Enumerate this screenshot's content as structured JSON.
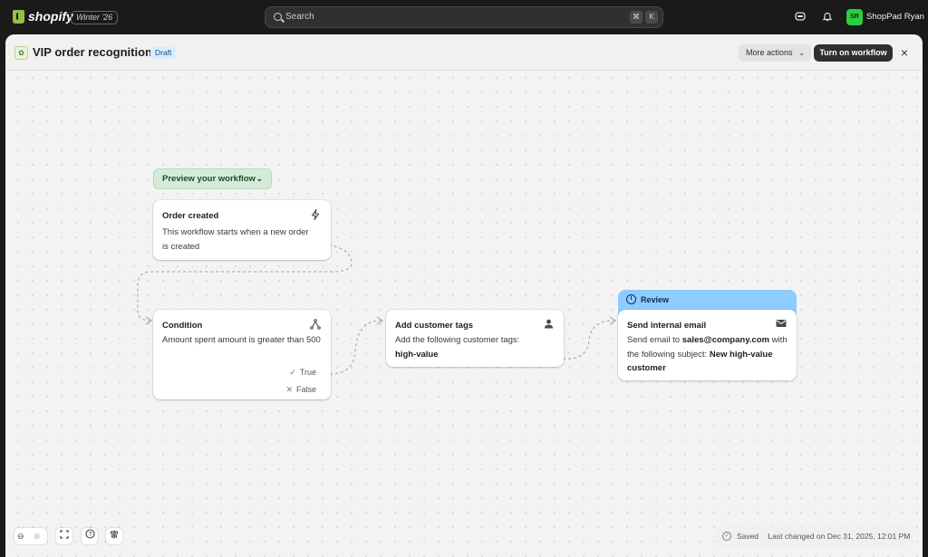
{
  "topbar": {
    "brand": "shopify",
    "edition": "Winter '26",
    "search_placeholder": "Search",
    "kbd_cmd": "⌘",
    "kbd_k": "K",
    "store_initials": "SR",
    "store_name": "ShopPad Ryan"
  },
  "header": {
    "title": "VIP order recognition",
    "status": "Draft",
    "more_actions_label": "More actions",
    "turn_on_label": "Turn on workflow"
  },
  "canvas": {
    "preview_label": "Preview your workflow",
    "trigger": {
      "title": "Order created",
      "body": "This workflow starts when a new order is created"
    },
    "condition": {
      "title": "Condition",
      "body": "Amount spent amount is greater than 500",
      "true_label": "True",
      "false_label": "False"
    },
    "action_tags": {
      "title": "Add customer tags",
      "body_prefix": "Add the following customer tags:",
      "tag": "high-value"
    },
    "review_label": "Review",
    "action_email": {
      "title": "Send internal email",
      "body_prefix": "Send email to",
      "email": "sales@company.com",
      "body_middle": "with the following subject:",
      "subject": "New high-value customer"
    }
  },
  "footer": {
    "saved_label": "Saved",
    "last_changed": "Last changed on Dec 31, 2025, 12:01 PM"
  },
  "colors": {
    "review_accent": "#8ecbff",
    "preview_pill": "#d5ebd9",
    "primary_button": "#2f2f2f",
    "avatar": "#2ecc40"
  }
}
